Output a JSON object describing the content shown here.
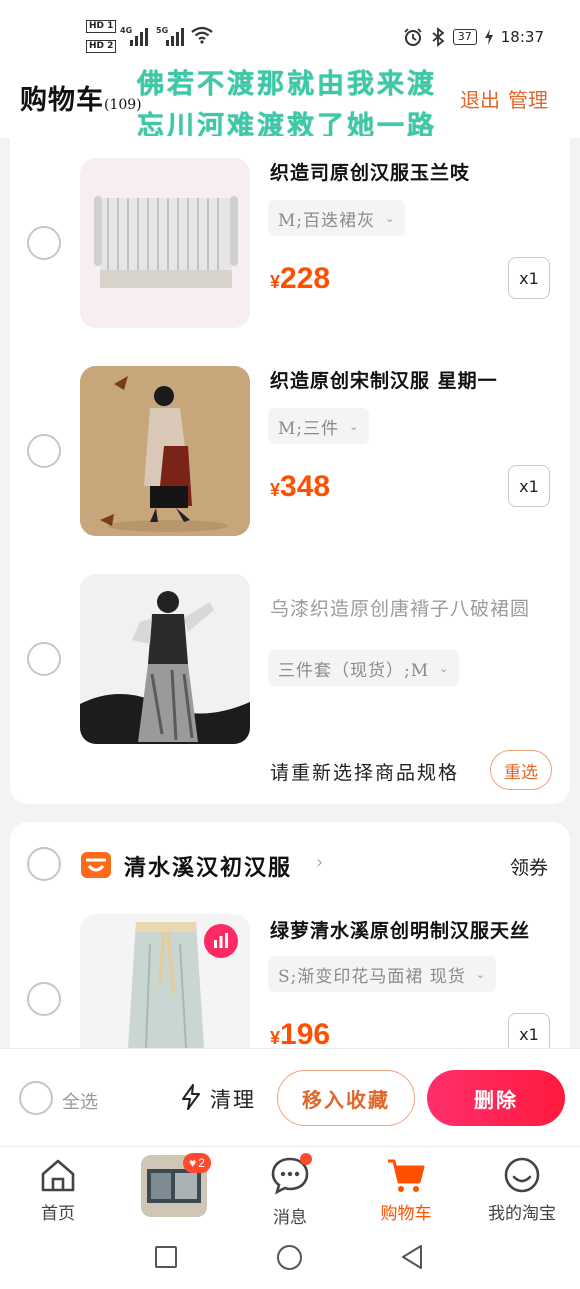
{
  "status_bar": {
    "hd1": "HD 1",
    "hd2": "HD 2",
    "net1": "4G",
    "net2": "5G",
    "battery": "37",
    "time": "18:37"
  },
  "header": {
    "title": "购物车",
    "count": "(109)",
    "overlay_line1": "佛若不渡那就由我来渡",
    "overlay_line2": "忘川河难渡救了她一路",
    "exit_label": "退出",
    "manage_label": "管理"
  },
  "cart_items": [
    {
      "title": "织造司原创汉服玉兰吱",
      "spec": "M;百迭裙灰",
      "price_symbol": "¥",
      "price": "228",
      "qty": "x1"
    },
    {
      "title": "织造原创宋制汉服 星期一",
      "spec": "M;三件",
      "price_symbol": "¥",
      "price": "348",
      "qty": "x1"
    },
    {
      "title": "乌漆织造原创唐褙子八破裙圆",
      "spec": "三件套（现货）;M",
      "reselect_text": "请重新选择商品规格",
      "reselect_button": "重选"
    }
  ],
  "shop": {
    "name": "清水溪汉初汉服",
    "coupon_label": "领券",
    "items": [
      {
        "title": "绿萝清水溪原创明制汉服天丝",
        "spec": "S;渐变印花马面裙 现货",
        "price_symbol": "¥",
        "price": "196",
        "qty": "x1"
      }
    ]
  },
  "action_bar": {
    "select_all": "全选",
    "clean": "清理",
    "move_to_favorites": "移入收藏",
    "delete": "删除"
  },
  "tab_bar": {
    "tabs": [
      {
        "label": "首页",
        "icon": "home-icon"
      },
      {
        "label": "",
        "icon": "promo-thumbnail",
        "badge": "2"
      },
      {
        "label": "消息",
        "icon": "message-icon"
      },
      {
        "label": "购物车",
        "icon": "cart-icon",
        "active": true
      },
      {
        "label": "我的淘宝",
        "icon": "profile-icon"
      }
    ]
  },
  "colors": {
    "accent": "#ff5000",
    "delete_gradient": "#ff1a3c",
    "outline_orange": "#e0662a",
    "overlay_text": "#3cc9a8"
  }
}
